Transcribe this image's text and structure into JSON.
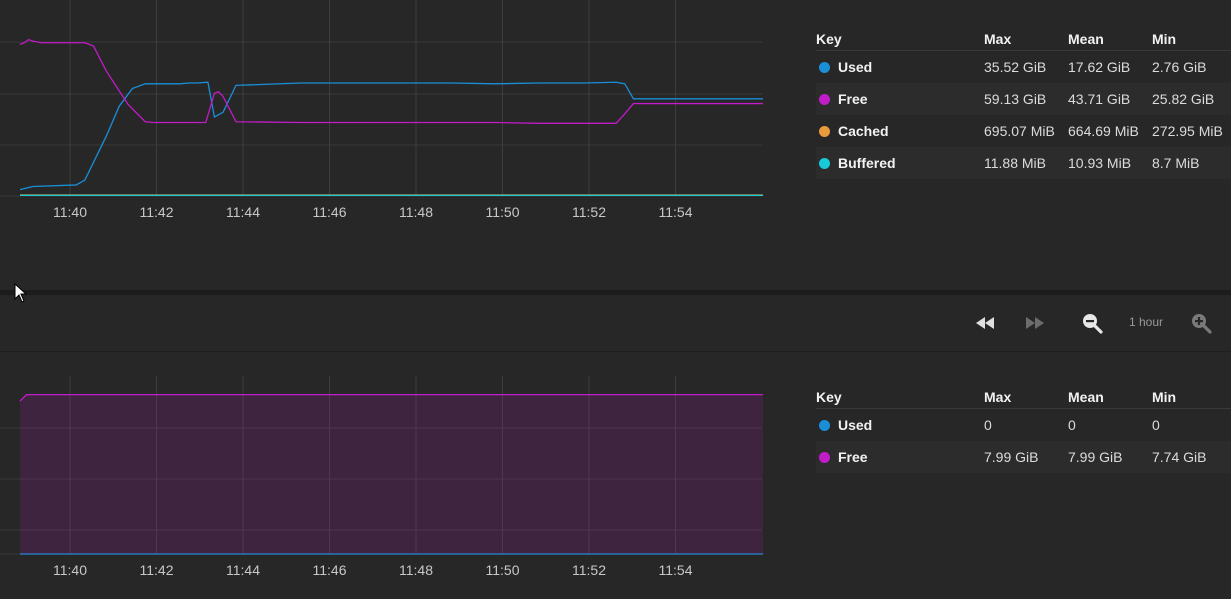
{
  "colors": {
    "used": "#1a8fd8",
    "free": "#c21bc8",
    "cached": "#e89a3c",
    "buffered": "#18c9d8",
    "grid": "#3d3d3d",
    "tick_text": "#c8c8c8"
  },
  "memory_panel": {
    "legend": {
      "headers": [
        "Key",
        "Max",
        "Mean",
        "Min"
      ],
      "rows": [
        {
          "key": "Used",
          "color": "#1a8fd8",
          "max": "35.52 GiB",
          "mean": "17.62 GiB",
          "min": "2.76 GiB"
        },
        {
          "key": "Free",
          "color": "#c21bc8",
          "max": "59.13 GiB",
          "mean": "43.71 GiB",
          "min": "25.82 GiB"
        },
        {
          "key": "Cached",
          "color": "#e89a3c",
          "max": "695.07 MiB",
          "mean": "664.69 MiB",
          "min": "272.95 MiB"
        },
        {
          "key": "Buffered",
          "color": "#18c9d8",
          "max": "11.88 MiB",
          "mean": "10.93 MiB",
          "min": "8.7 MiB"
        }
      ]
    }
  },
  "swap_panel": {
    "legend": {
      "headers": [
        "Key",
        "Max",
        "Mean",
        "Min"
      ],
      "rows": [
        {
          "key": "Used",
          "color": "#1a8fd8",
          "max": "0",
          "mean": "0",
          "min": "0"
        },
        {
          "key": "Free",
          "color": "#c21bc8",
          "max": "7.99 GiB",
          "mean": "7.99 GiB",
          "min": "7.74 GiB"
        }
      ]
    }
  },
  "toolbar": {
    "rewind_icon": "rewind-icon",
    "forward_icon": "fast-forward-icon",
    "zoom_out_icon": "zoom-out-icon",
    "zoom_in_icon": "zoom-in-icon",
    "range_label": "1 hour"
  },
  "chart_data": [
    {
      "type": "line",
      "x_ticks": [
        "11:40",
        "11:42",
        "11:44",
        "11:46",
        "11:48",
        "11:50",
        "11:52",
        "11:54"
      ],
      "xlim": [
        "11:38.8",
        "11:56"
      ],
      "ylim": [
        0,
        1
      ],
      "grid": true,
      "y_tick_labels_visible": false,
      "series": [
        {
          "name": "Used",
          "color": "#1a8fd8",
          "x": [
            0,
            0.3,
            1.3,
            1.5,
            2.0,
            2.3,
            2.6,
            2.9,
            3.2,
            3.5,
            3.7,
            3.9,
            4.1,
            4.35,
            4.5,
            4.7,
            5.0,
            6.5,
            7.5,
            8.5,
            9.5,
            10.0,
            11.0,
            12.0,
            13.0,
            13.8,
            14.0,
            14.2,
            15.0,
            16.0,
            17.2
          ],
          "y": [
            0.04,
            0.06,
            0.07,
            0.1,
            0.38,
            0.57,
            0.68,
            0.71,
            0.71,
            0.71,
            0.71,
            0.715,
            0.715,
            0.72,
            0.5,
            0.53,
            0.7,
            0.715,
            0.715,
            0.715,
            0.715,
            0.715,
            0.71,
            0.715,
            0.715,
            0.72,
            0.71,
            0.615,
            0.615,
            0.615,
            0.615
          ]
        },
        {
          "name": "Free",
          "color": "#c21bc8",
          "x": [
            0,
            0.1,
            0.2,
            0.3,
            0.5,
            0.8,
            1.0,
            1.2,
            1.5,
            1.7,
            2.0,
            2.5,
            2.9,
            3.1,
            3.5,
            4.0,
            4.3,
            4.5,
            4.6,
            4.7,
            5.0,
            6.5,
            8.5,
            11.0,
            12.0,
            13.0,
            13.8,
            14.0,
            14.2,
            15.0,
            16.0,
            17.2
          ],
          "y": [
            0.96,
            0.97,
            0.99,
            0.98,
            0.97,
            0.97,
            0.97,
            0.97,
            0.97,
            0.95,
            0.79,
            0.58,
            0.47,
            0.465,
            0.465,
            0.465,
            0.465,
            0.65,
            0.66,
            0.63,
            0.47,
            0.465,
            0.465,
            0.465,
            0.46,
            0.46,
            0.46,
            0.52,
            0.585,
            0.585,
            0.585,
            0.585
          ]
        },
        {
          "name": "Cached",
          "color": "#e89a3c",
          "x": [
            0,
            17.2
          ],
          "y": [
            0.006,
            0.006
          ]
        },
        {
          "name": "Buffered",
          "color": "#18c9d8",
          "x": [
            0,
            17.2
          ],
          "y": [
            0.004,
            0.004
          ]
        }
      ]
    },
    {
      "type": "area",
      "x_ticks": [
        "11:40",
        "11:42",
        "11:44",
        "11:46",
        "11:48",
        "11:50",
        "11:52",
        "11:54"
      ],
      "xlim": [
        "11:38.8",
        "11:56"
      ],
      "ylim": [
        0,
        1
      ],
      "grid": true,
      "y_tick_labels_visible": false,
      "series": [
        {
          "name": "Used",
          "color": "#1a8fd8",
          "x": [
            0,
            17.2
          ],
          "y": [
            0,
            0
          ]
        },
        {
          "name": "Free",
          "color": "#c21bc8",
          "x": [
            0,
            0.15,
            17.2
          ],
          "y": [
            0.95,
            0.99,
            0.99
          ]
        }
      ]
    }
  ]
}
